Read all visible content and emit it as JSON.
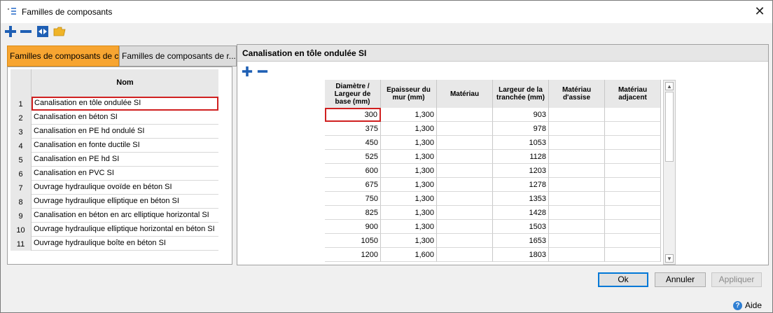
{
  "window": {
    "title": "Familles de composants",
    "close_glyph": "✕"
  },
  "toolbar": {
    "icons": [
      "add-icon",
      "remove-icon",
      "import-icon",
      "open-folder-icon"
    ],
    "accent": "#1e5fb4"
  },
  "tabs": [
    {
      "label": "Familles de composants de c..."
    },
    {
      "label": "Familles de composants de r..."
    }
  ],
  "left_grid": {
    "header": "Nom",
    "rows": [
      {
        "num": "1",
        "name": "Canalisation en tôle ondulée SI"
      },
      {
        "num": "2",
        "name": "Canalisation en béton SI"
      },
      {
        "num": "3",
        "name": "Canalisation en PE hd ondulé SI"
      },
      {
        "num": "4",
        "name": "Canalisation en fonte ductile SI"
      },
      {
        "num": "5",
        "name": "Canalisation en PE hd SI"
      },
      {
        "num": "6",
        "name": "Canalisation en PVC SI"
      },
      {
        "num": "7",
        "name": "Ouvrage hydraulique ovoïde en béton SI"
      },
      {
        "num": "8",
        "name": "Ouvrage hydraulique elliptique en béton SI"
      },
      {
        "num": "9",
        "name": "Canalisation en béton en arc elliptique horizontal SI"
      },
      {
        "num": "10",
        "name": "Ouvrage hydraulique elliptique horizontal en béton SI"
      },
      {
        "num": "11",
        "name": "Ouvrage hydraulique boîte en béton SI"
      }
    ]
  },
  "right_panel": {
    "title": "Canalisation en tôle ondulée SI",
    "columns": [
      "Diamètre / Largeur de base (mm)",
      "Epaisseur du mur (mm)",
      "Matériau",
      "Largeur de la tranchée (mm)",
      "Matériau d'assise",
      "Matériau adjacent"
    ],
    "rows": [
      [
        "300",
        "1,300",
        "",
        "903",
        "",
        ""
      ],
      [
        "375",
        "1,300",
        "",
        "978",
        "",
        ""
      ],
      [
        "450",
        "1,300",
        "",
        "1053",
        "",
        ""
      ],
      [
        "525",
        "1,300",
        "",
        "1128",
        "",
        ""
      ],
      [
        "600",
        "1,300",
        "",
        "1203",
        "",
        ""
      ],
      [
        "675",
        "1,300",
        "",
        "1278",
        "",
        ""
      ],
      [
        "750",
        "1,300",
        "",
        "1353",
        "",
        ""
      ],
      [
        "825",
        "1,300",
        "",
        "1428",
        "",
        ""
      ],
      [
        "900",
        "1,300",
        "",
        "1503",
        "",
        ""
      ],
      [
        "1050",
        "1,300",
        "",
        "1653",
        "",
        ""
      ],
      [
        "1200",
        "1,600",
        "",
        "1803",
        "",
        ""
      ]
    ]
  },
  "buttons": {
    "ok": "Ok",
    "cancel": "Annuler",
    "apply": "Appliquer"
  },
  "help": {
    "label": "Aide"
  },
  "colors": {
    "active_tab": "#f7a531",
    "selection_border": "#d02020",
    "primary_border": "#0078d7"
  }
}
